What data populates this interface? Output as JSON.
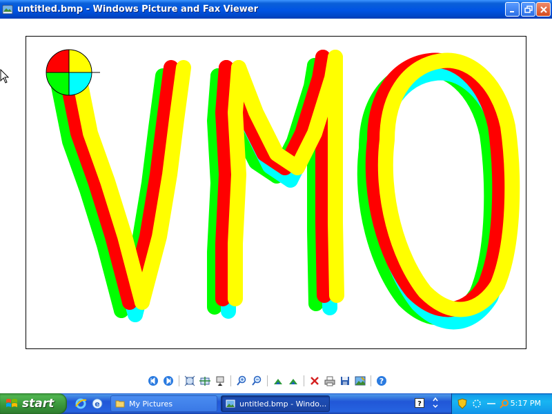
{
  "window": {
    "title": "untitled.bmp - Windows Picture and Fax Viewer"
  },
  "image": {
    "drawn_text": "VMO",
    "colors": [
      "#ff0000",
      "#ffff00",
      "#00ff00",
      "#00ffff"
    ]
  },
  "toolbar": {
    "tools": [
      "previous-image-icon",
      "next-image-icon",
      "best-fit-icon",
      "actual-size-icon",
      "slideshow-icon",
      "zoom-in-icon",
      "zoom-out-icon",
      "rotate-clockwise-icon",
      "rotate-counterclockwise-icon",
      "delete-icon",
      "print-icon",
      "save-icon",
      "edit-icon",
      "help-icon"
    ]
  },
  "taskbar": {
    "start_label": "start",
    "tasks": [
      {
        "label": "My Pictures",
        "active": false
      },
      {
        "label": "untitled.bmp - Windo...",
        "active": true
      }
    ],
    "clock": "5:17 PM"
  },
  "colors": {
    "title_bar": "#0054e3",
    "taskbar": "#2157d7",
    "start_button": "#38943a",
    "tray": "#18b5f2"
  }
}
